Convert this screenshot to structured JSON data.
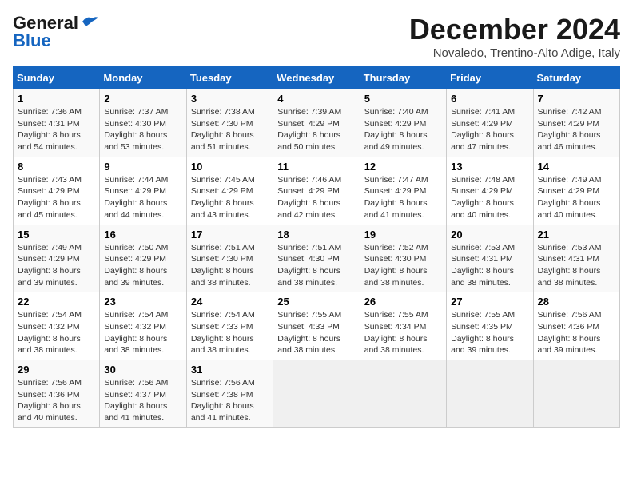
{
  "logo": {
    "general": "General",
    "blue": "Blue"
  },
  "title": "December 2024",
  "subtitle": "Novaledo, Trentino-Alto Adige, Italy",
  "days_of_week": [
    "Sunday",
    "Monday",
    "Tuesday",
    "Wednesday",
    "Thursday",
    "Friday",
    "Saturday"
  ],
  "weeks": [
    [
      {
        "day": "1",
        "info": "Sunrise: 7:36 AM\nSunset: 4:31 PM\nDaylight: 8 hours\nand 54 minutes."
      },
      {
        "day": "2",
        "info": "Sunrise: 7:37 AM\nSunset: 4:30 PM\nDaylight: 8 hours\nand 53 minutes."
      },
      {
        "day": "3",
        "info": "Sunrise: 7:38 AM\nSunset: 4:30 PM\nDaylight: 8 hours\nand 51 minutes."
      },
      {
        "day": "4",
        "info": "Sunrise: 7:39 AM\nSunset: 4:29 PM\nDaylight: 8 hours\nand 50 minutes."
      },
      {
        "day": "5",
        "info": "Sunrise: 7:40 AM\nSunset: 4:29 PM\nDaylight: 8 hours\nand 49 minutes."
      },
      {
        "day": "6",
        "info": "Sunrise: 7:41 AM\nSunset: 4:29 PM\nDaylight: 8 hours\nand 47 minutes."
      },
      {
        "day": "7",
        "info": "Sunrise: 7:42 AM\nSunset: 4:29 PM\nDaylight: 8 hours\nand 46 minutes."
      }
    ],
    [
      {
        "day": "8",
        "info": "Sunrise: 7:43 AM\nSunset: 4:29 PM\nDaylight: 8 hours\nand 45 minutes."
      },
      {
        "day": "9",
        "info": "Sunrise: 7:44 AM\nSunset: 4:29 PM\nDaylight: 8 hours\nand 44 minutes."
      },
      {
        "day": "10",
        "info": "Sunrise: 7:45 AM\nSunset: 4:29 PM\nDaylight: 8 hours\nand 43 minutes."
      },
      {
        "day": "11",
        "info": "Sunrise: 7:46 AM\nSunset: 4:29 PM\nDaylight: 8 hours\nand 42 minutes."
      },
      {
        "day": "12",
        "info": "Sunrise: 7:47 AM\nSunset: 4:29 PM\nDaylight: 8 hours\nand 41 minutes."
      },
      {
        "day": "13",
        "info": "Sunrise: 7:48 AM\nSunset: 4:29 PM\nDaylight: 8 hours\nand 40 minutes."
      },
      {
        "day": "14",
        "info": "Sunrise: 7:49 AM\nSunset: 4:29 PM\nDaylight: 8 hours\nand 40 minutes."
      }
    ],
    [
      {
        "day": "15",
        "info": "Sunrise: 7:49 AM\nSunset: 4:29 PM\nDaylight: 8 hours\nand 39 minutes."
      },
      {
        "day": "16",
        "info": "Sunrise: 7:50 AM\nSunset: 4:29 PM\nDaylight: 8 hours\nand 39 minutes."
      },
      {
        "day": "17",
        "info": "Sunrise: 7:51 AM\nSunset: 4:30 PM\nDaylight: 8 hours\nand 38 minutes."
      },
      {
        "day": "18",
        "info": "Sunrise: 7:51 AM\nSunset: 4:30 PM\nDaylight: 8 hours\nand 38 minutes."
      },
      {
        "day": "19",
        "info": "Sunrise: 7:52 AM\nSunset: 4:30 PM\nDaylight: 8 hours\nand 38 minutes."
      },
      {
        "day": "20",
        "info": "Sunrise: 7:53 AM\nSunset: 4:31 PM\nDaylight: 8 hours\nand 38 minutes."
      },
      {
        "day": "21",
        "info": "Sunrise: 7:53 AM\nSunset: 4:31 PM\nDaylight: 8 hours\nand 38 minutes."
      }
    ],
    [
      {
        "day": "22",
        "info": "Sunrise: 7:54 AM\nSunset: 4:32 PM\nDaylight: 8 hours\nand 38 minutes."
      },
      {
        "day": "23",
        "info": "Sunrise: 7:54 AM\nSunset: 4:32 PM\nDaylight: 8 hours\nand 38 minutes."
      },
      {
        "day": "24",
        "info": "Sunrise: 7:54 AM\nSunset: 4:33 PM\nDaylight: 8 hours\nand 38 minutes."
      },
      {
        "day": "25",
        "info": "Sunrise: 7:55 AM\nSunset: 4:33 PM\nDaylight: 8 hours\nand 38 minutes."
      },
      {
        "day": "26",
        "info": "Sunrise: 7:55 AM\nSunset: 4:34 PM\nDaylight: 8 hours\nand 38 minutes."
      },
      {
        "day": "27",
        "info": "Sunrise: 7:55 AM\nSunset: 4:35 PM\nDaylight: 8 hours\nand 39 minutes."
      },
      {
        "day": "28",
        "info": "Sunrise: 7:56 AM\nSunset: 4:36 PM\nDaylight: 8 hours\nand 39 minutes."
      }
    ],
    [
      {
        "day": "29",
        "info": "Sunrise: 7:56 AM\nSunset: 4:36 PM\nDaylight: 8 hours\nand 40 minutes."
      },
      {
        "day": "30",
        "info": "Sunrise: 7:56 AM\nSunset: 4:37 PM\nDaylight: 8 hours\nand 41 minutes."
      },
      {
        "day": "31",
        "info": "Sunrise: 7:56 AM\nSunset: 4:38 PM\nDaylight: 8 hours\nand 41 minutes."
      },
      {
        "day": "",
        "info": ""
      },
      {
        "day": "",
        "info": ""
      },
      {
        "day": "",
        "info": ""
      },
      {
        "day": "",
        "info": ""
      }
    ]
  ]
}
